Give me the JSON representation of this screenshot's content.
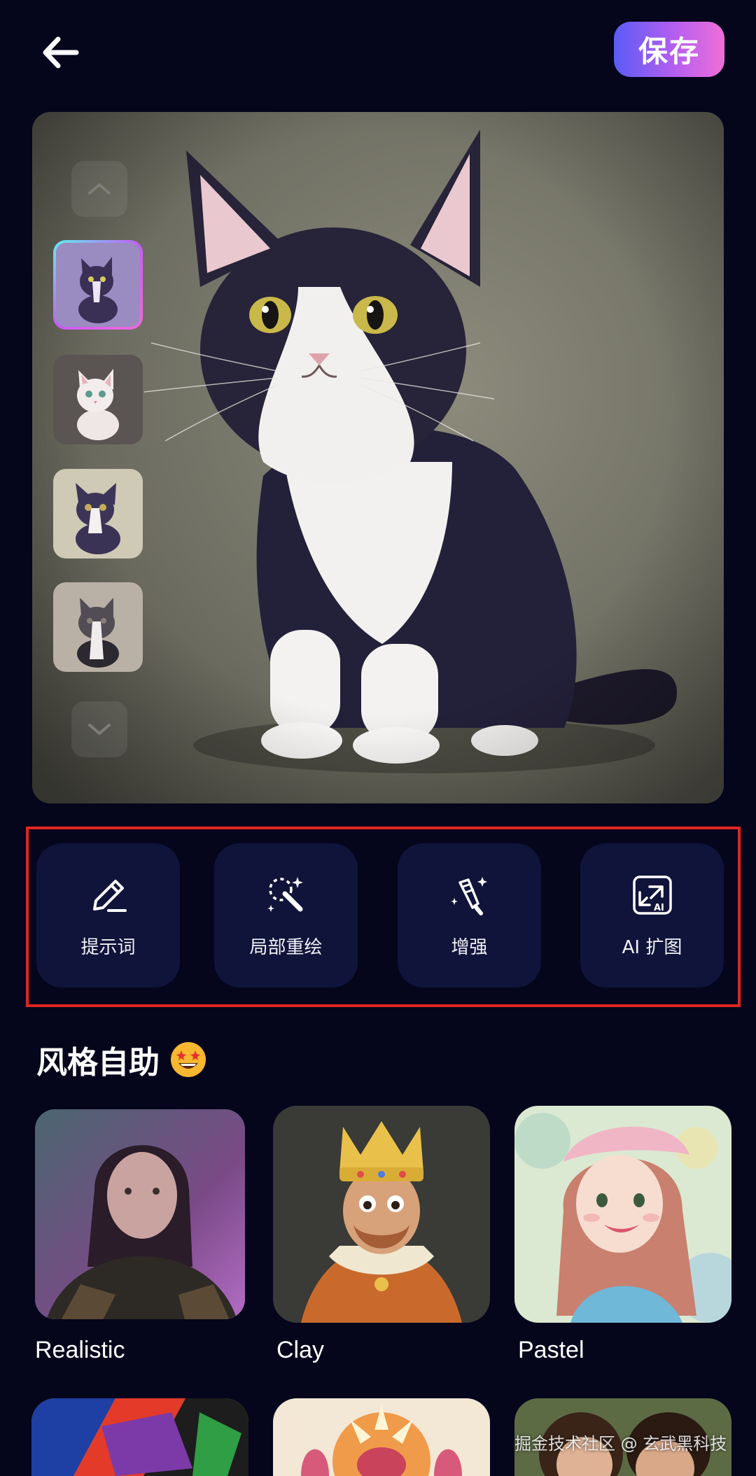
{
  "header": {
    "back_icon": "arrow-left-icon",
    "save_label": "保存"
  },
  "preview": {
    "thumbnail_count": 4,
    "selected_thumbnail": 1,
    "nav_up_icon": "chevron-up-icon",
    "nav_down_icon": "chevron-down-icon"
  },
  "tools": [
    {
      "label": "提示词",
      "icon": "pencil-icon"
    },
    {
      "label": "局部重绘",
      "icon": "magic-wand-icon"
    },
    {
      "label": "增强",
      "icon": "enhance-wand-icon"
    },
    {
      "label": "AI 扩图",
      "icon": "ai-expand-icon"
    }
  ],
  "styles": {
    "title": "风格自助",
    "title_emoji": "star-struck-emoji-icon",
    "items": [
      {
        "label": "Realistic",
        "selected": true
      },
      {
        "label": "Clay",
        "selected": false
      },
      {
        "label": "Pastel",
        "selected": false
      }
    ]
  },
  "watermark": "掘金技术社区 @ 玄武黑科技",
  "colors": {
    "background": "#05051c",
    "tool_bg": "#10143a",
    "highlight_frame": "#e0261f",
    "save_gradient_start": "#5a5cf5",
    "save_gradient_end": "#ef6fd6"
  }
}
